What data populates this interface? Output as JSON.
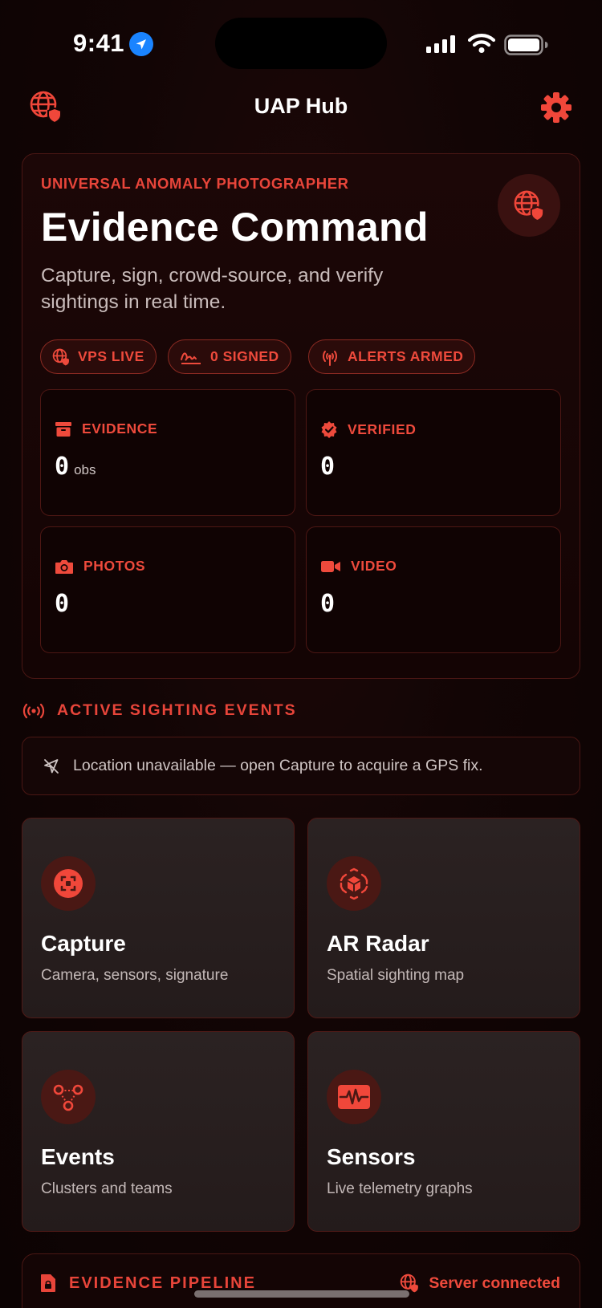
{
  "status_bar": {
    "time": "9:41"
  },
  "nav": {
    "title": "UAP Hub",
    "left_icon": "globe-lock-icon",
    "right_icon": "gear-icon"
  },
  "hero": {
    "eyebrow": "UNIVERSAL ANOMALY PHOTOGRAPHER",
    "title": "Evidence Command",
    "subtitle": "Capture, sign, crowd-source, and verify sightings in real time.",
    "pills": [
      {
        "label": "VPS LIVE",
        "icon": "globe-lock-icon"
      },
      {
        "label": "0 SIGNED",
        "icon": "signature-icon"
      },
      {
        "label": "ALERTS ARMED",
        "icon": "antenna-icon"
      }
    ],
    "stats": [
      {
        "label": "EVIDENCE",
        "value": "0",
        "unit": "obs",
        "icon": "archive-box-icon"
      },
      {
        "label": "VERIFIED",
        "value": "0",
        "unit": "",
        "icon": "verified-seal-icon"
      },
      {
        "label": "PHOTOS",
        "value": "0",
        "unit": "",
        "icon": "camera-icon"
      },
      {
        "label": "VIDEO",
        "value": "0",
        "unit": "",
        "icon": "video-camera-icon"
      }
    ]
  },
  "sightings": {
    "header": "ACTIVE SIGHTING EVENTS",
    "location_message": "Location unavailable — open Capture to acquire a GPS fix."
  },
  "tiles": [
    {
      "title": "Capture",
      "subtitle": "Camera, sensors, signature",
      "icon": "viewfinder-icon"
    },
    {
      "title": "AR Radar",
      "subtitle": "Spatial sighting map",
      "icon": "ar-cube-icon"
    },
    {
      "title": "Events",
      "subtitle": "Clusters and teams",
      "icon": "cluster-nodes-icon"
    },
    {
      "title": "Sensors",
      "subtitle": "Live telemetry graphs",
      "icon": "waveform-icon"
    }
  ],
  "pipeline": {
    "header": "EVIDENCE PIPELINE",
    "status": "Server connected"
  },
  "colors": {
    "accent": "#f0473a",
    "background": "#120505",
    "tile": "#2a2121"
  }
}
